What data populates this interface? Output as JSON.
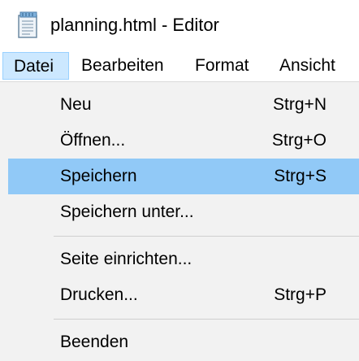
{
  "window": {
    "title": "planning.html - Editor",
    "icon": "notepad-icon"
  },
  "menubar": {
    "items": [
      {
        "label": "Datei",
        "active": true
      },
      {
        "label": "Bearbeiten"
      },
      {
        "label": "Format"
      },
      {
        "label": "Ansicht"
      }
    ]
  },
  "file_menu": {
    "items": [
      {
        "label": "Neu",
        "shortcut": "Strg+N"
      },
      {
        "label": "Öffnen...",
        "shortcut": "Strg+O"
      },
      {
        "label": "Speichern",
        "shortcut": "Strg+S",
        "highlighted": true
      },
      {
        "label": "Speichern unter...",
        "shortcut": ""
      },
      {
        "label": "Seite einrichten...",
        "shortcut": ""
      },
      {
        "label": "Drucken...",
        "shortcut": "Strg+P"
      },
      {
        "label": "Beenden",
        "shortcut": ""
      }
    ]
  },
  "colors": {
    "menu_background": "#f2f2f2",
    "highlight": "#91c9f7",
    "active_menubar_item": "#cce8ff"
  }
}
